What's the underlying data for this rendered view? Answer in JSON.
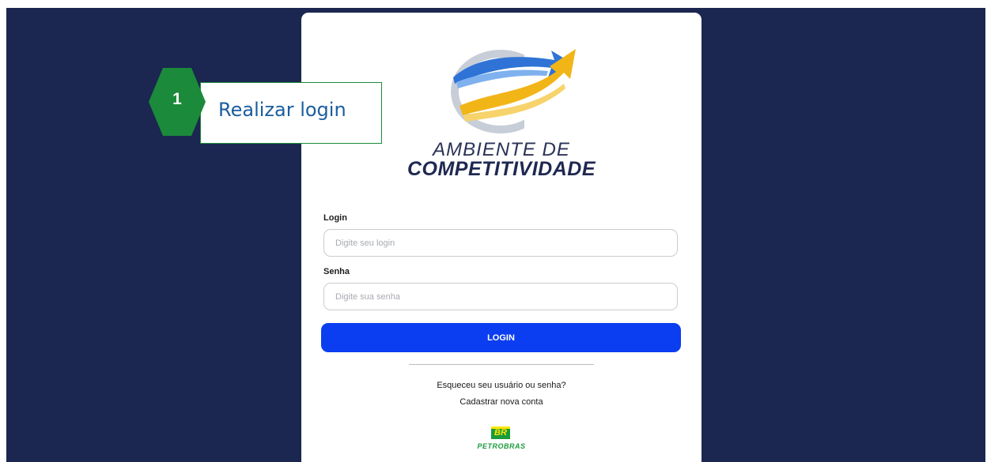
{
  "logo": {
    "line1": "AMBIENTE DE",
    "line2": "COMPETITIVIDADE",
    "colors": {
      "swoosh_blue": "#2f73d6",
      "arrow_yellow": "#f2b517",
      "ring_grey": "#c8ced8"
    }
  },
  "form": {
    "login_label": "Login",
    "login_placeholder": "Digite seu login",
    "password_label": "Senha",
    "password_placeholder": "Digite sua senha",
    "submit_label": "LOGIN"
  },
  "links": {
    "forgot": "Esqueceu seu usuário ou senha?",
    "register": "Cadastrar nova conta"
  },
  "footer_logo": {
    "badge": "BR",
    "name": "PETROBRAS"
  },
  "callout": {
    "number": "1",
    "text": "Realizar login",
    "colors": {
      "badge": "#1b8a3a",
      "text": "#1b5e9e"
    }
  },
  "colors": {
    "background": "#1b2750",
    "button": "#0a3ef0"
  }
}
